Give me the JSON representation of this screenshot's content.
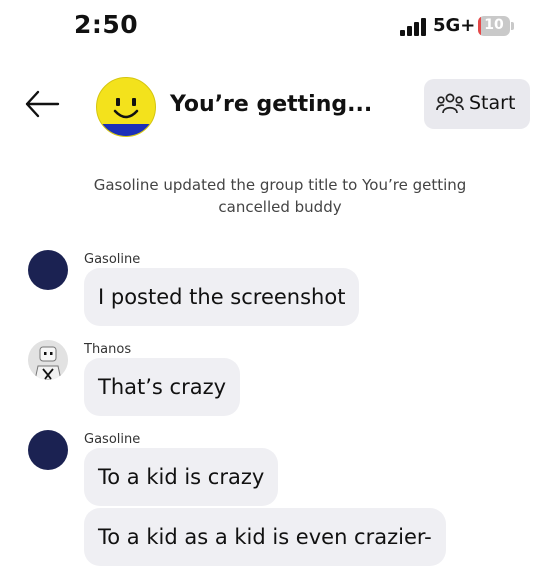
{
  "status_bar": {
    "time": "2:50",
    "network": "5G+",
    "battery_level": "10",
    "battery_fraction": 0.1,
    "battery_color": "#e54848"
  },
  "header": {
    "back_icon": "arrow-left-icon",
    "group_title": "You’re getting...",
    "start_icon": "people-group-icon",
    "start_label": "Start"
  },
  "system_message": "Gasoline updated the group title to You’re getting cancelled buddy",
  "messages": [
    {
      "sender": "Gasoline",
      "text": "I posted the screenshot"
    },
    {
      "sender": "Thanos",
      "text": "That’s crazy"
    },
    {
      "sender": "Gasoline",
      "text": "To a kid is crazy"
    },
    {
      "sender": "",
      "text": "To a kid as a kid is even crazier-"
    }
  ],
  "colors": {
    "bubble": "#efeff3",
    "avatar_navy": "#1b2252",
    "group_avatar_yellow": "#f3e21c",
    "group_avatar_blue": "#1c2fb8"
  }
}
